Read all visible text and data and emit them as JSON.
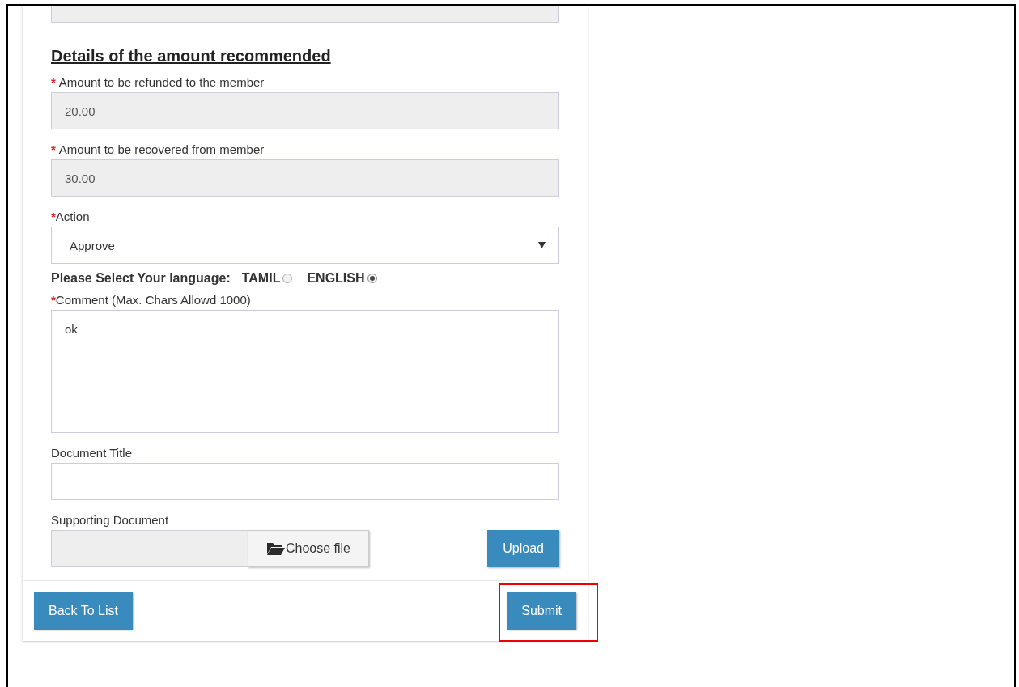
{
  "section_title": "Details of the amount recommended",
  "amount_fields": [
    {
      "mark": "*",
      "label": "Amount to be refunded to the member",
      "value": "20.00"
    },
    {
      "mark": "*",
      "label": "Amount to be recovered from member",
      "value": "30.00"
    }
  ],
  "action": {
    "mark": "*",
    "label": "Action",
    "value": "Approve"
  },
  "language": {
    "label": "Please Select Your language:",
    "options": [
      {
        "label": "TAMIL",
        "selected": false
      },
      {
        "label": "ENGLISH",
        "selected": true
      }
    ]
  },
  "comment": {
    "mark": "*",
    "label": "Comment (Max. Chars Allowd 1000)",
    "value": "ok"
  },
  "document_title": {
    "label": "Document Title"
  },
  "supporting_document": {
    "label": "Supporting Document",
    "choose_label": "Choose file",
    "upload_label": "Upload"
  },
  "buttons": [
    {
      "label": "Back To List",
      "highlighted": false
    },
    {
      "label": "Submit",
      "highlighted": true
    }
  ]
}
